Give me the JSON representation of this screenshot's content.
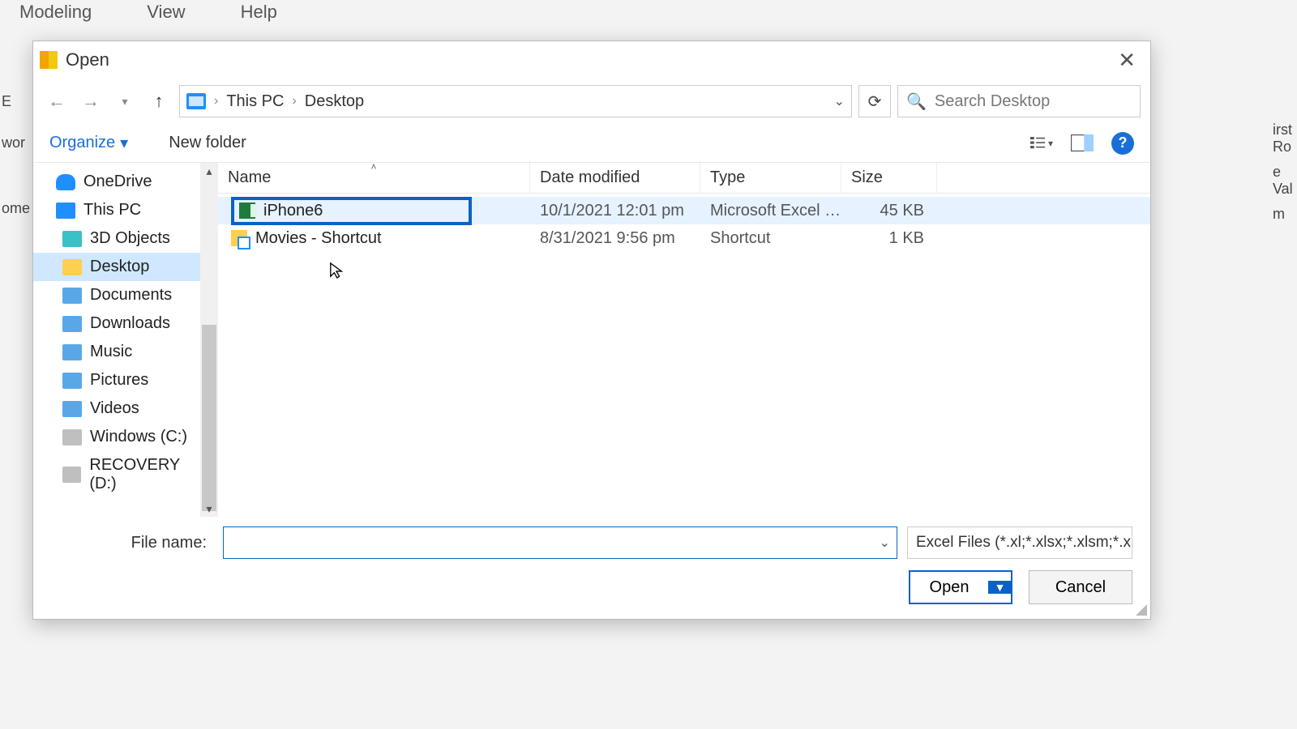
{
  "app_bg": {
    "menu": [
      "Modeling",
      "View",
      "Help"
    ],
    "left_labels": [
      "E",
      "wor",
      "ome"
    ],
    "right_labels": [
      "irst Ro",
      "e Val",
      "m"
    ]
  },
  "dialog": {
    "title": "Open",
    "close_glyph": "✕",
    "nav": {
      "back_glyph": "←",
      "forward_glyph": "→",
      "recent_glyph": "▾",
      "up_glyph": "↑"
    },
    "breadcrumb": {
      "items": [
        "This PC",
        "Desktop"
      ],
      "sep": "›",
      "dropdown_glyph": "⌄"
    },
    "reload_glyph": "⟳",
    "search": {
      "icon": "🔍",
      "placeholder": "Search Desktop"
    },
    "toolbar": {
      "organize": "Organize",
      "organize_caret": "▾",
      "new_folder": "New folder",
      "view_caret": "▾",
      "help": "?"
    },
    "tree": [
      {
        "icon": "cloud",
        "label": "OneDrive",
        "level": 0
      },
      {
        "icon": "pc",
        "label": "This PC",
        "level": 0
      },
      {
        "icon": "cube",
        "label": "3D Objects",
        "level": 1
      },
      {
        "icon": "folder",
        "label": "Desktop",
        "level": 1,
        "selected": true
      },
      {
        "icon": "doc",
        "label": "Documents",
        "level": 1
      },
      {
        "icon": "dl",
        "label": "Downloads",
        "level": 1
      },
      {
        "icon": "mus",
        "label": "Music",
        "level": 1
      },
      {
        "icon": "pic",
        "label": "Pictures",
        "level": 1
      },
      {
        "icon": "vid",
        "label": "Videos",
        "level": 1
      },
      {
        "icon": "disc",
        "label": "Windows (C:)",
        "level": 1
      },
      {
        "icon": "disc",
        "label": "RECOVERY (D:)",
        "level": 1
      }
    ],
    "columns": {
      "name": "Name",
      "date": "Date modified",
      "type": "Type",
      "size": "Size",
      "sort_glyph": "˄"
    },
    "files": [
      {
        "icon": "xls",
        "name": "iPhone6",
        "date": "10/1/2021 12:01 pm",
        "type": "Microsoft Excel W…",
        "size": "45 KB",
        "selected": true
      },
      {
        "icon": "sc",
        "name": "Movies - Shortcut",
        "date": "8/31/2021 9:56 pm",
        "type": "Shortcut",
        "size": "1 KB",
        "selected": false
      }
    ],
    "footer": {
      "filename_label": "File name:",
      "filename_value": "",
      "filetype_label": "Excel Files (*.xl;*.xlsx;*.xlsm;*.xl",
      "open_label": "Open",
      "open_split_glyph": "▼",
      "cancel_label": "Cancel"
    }
  }
}
